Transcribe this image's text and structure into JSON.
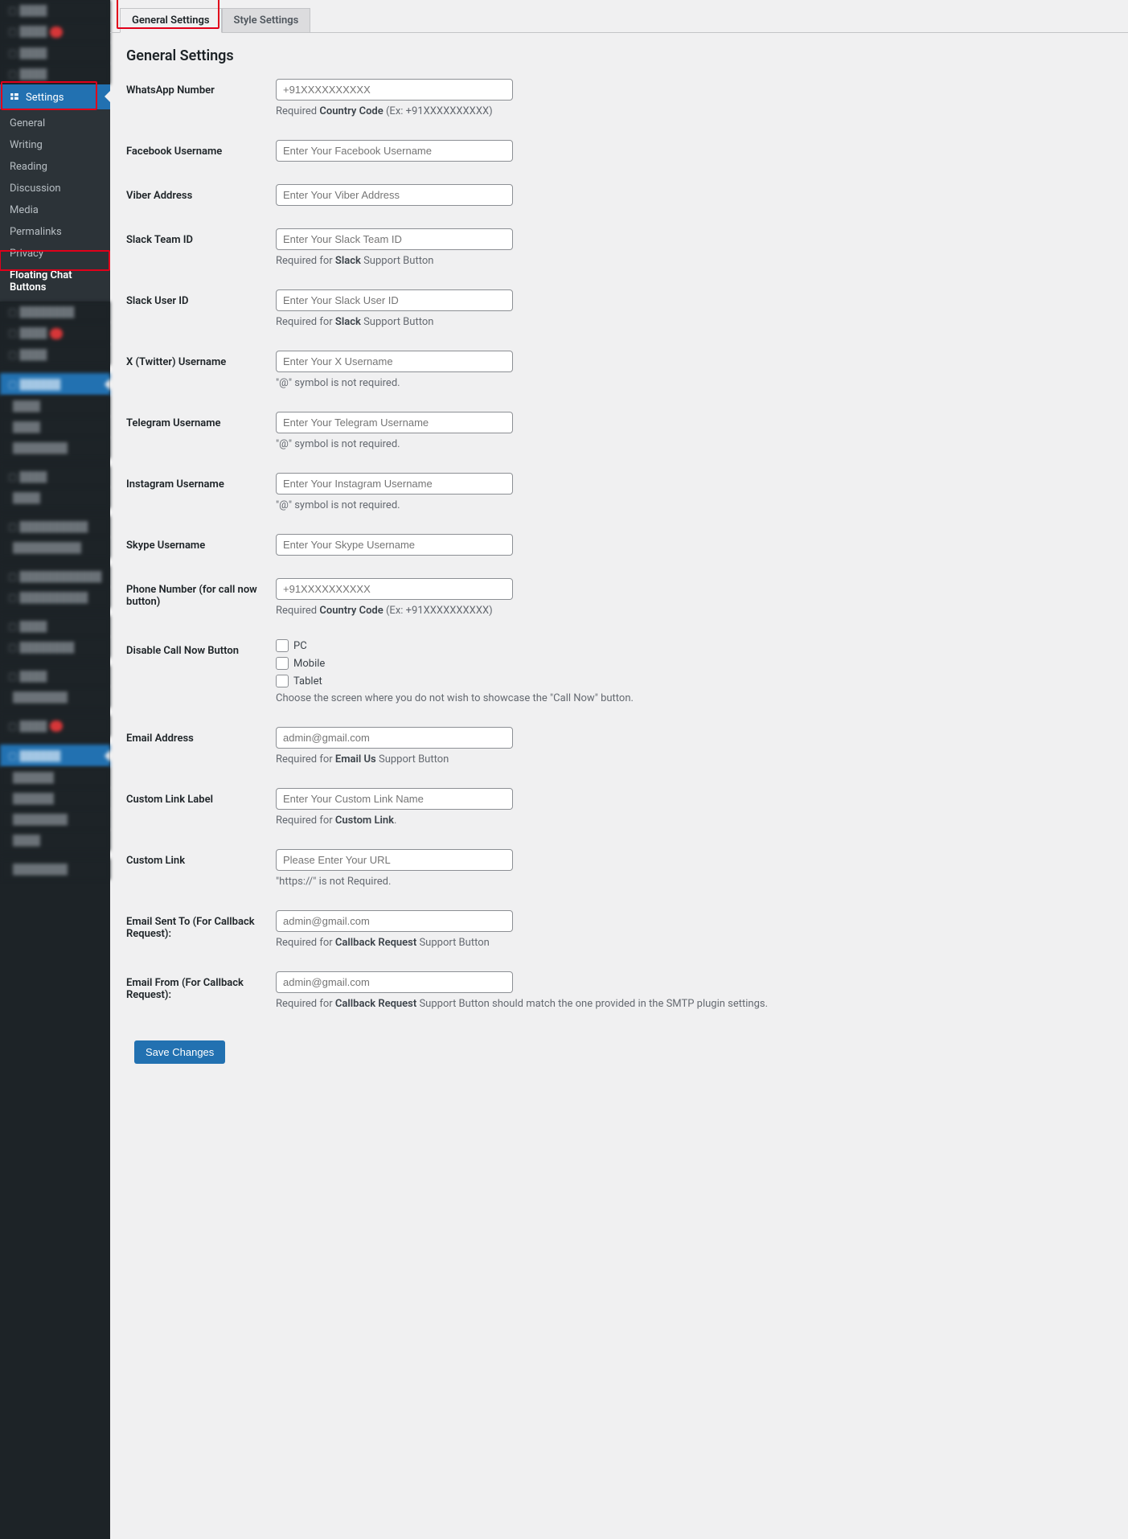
{
  "sidebar": {
    "settings_label": "Settings",
    "sub_items": [
      "General",
      "Writing",
      "Reading",
      "Discussion",
      "Media",
      "Permalinks",
      "Privacy",
      "Floating Chat Buttons"
    ]
  },
  "tabs": {
    "general": "General Settings",
    "style": "Style Settings"
  },
  "page_title": "General Settings",
  "fields": {
    "whatsapp": {
      "label": "WhatsApp Number",
      "placeholder": "+91XXXXXXXXXX",
      "desc_prefix": "Required ",
      "desc_bold": "Country Code",
      "desc_suffix": " (Ex: +91XXXXXXXXXX)"
    },
    "facebook": {
      "label": "Facebook Username",
      "placeholder": "Enter Your Facebook Username"
    },
    "viber": {
      "label": "Viber Address",
      "placeholder": "Enter Your Viber Address"
    },
    "slack_team": {
      "label": "Slack Team ID",
      "placeholder": "Enter Your Slack Team ID",
      "desc_prefix": "Required for ",
      "desc_bold": "Slack",
      "desc_suffix": " Support Button"
    },
    "slack_user": {
      "label": "Slack User ID",
      "placeholder": "Enter Your Slack User ID",
      "desc_prefix": "Required for ",
      "desc_bold": "Slack",
      "desc_suffix": " Support Button"
    },
    "twitter": {
      "label": "X (Twitter) Username",
      "placeholder": "Enter Your X Username",
      "desc_plain": "\"@\" symbol is not required."
    },
    "telegram": {
      "label": "Telegram Username",
      "placeholder": "Enter Your Telegram Username",
      "desc_plain": "\"@\" symbol is not required."
    },
    "instagram": {
      "label": "Instagram Username",
      "placeholder": "Enter Your Instagram Username",
      "desc_plain": "\"@\" symbol is not required."
    },
    "skype": {
      "label": "Skype Username",
      "placeholder": "Enter Your Skype Username"
    },
    "phone": {
      "label": "Phone Number (for call now button)",
      "placeholder": "+91XXXXXXXXXX",
      "desc_prefix": "Required ",
      "desc_bold": "Country Code",
      "desc_suffix": " (Ex: +91XXXXXXXXXX)"
    },
    "disable_call": {
      "label": "Disable Call Now Button",
      "opt_pc": "PC",
      "opt_mobile": "Mobile",
      "opt_tablet": "Tablet",
      "desc_plain": "Choose the screen where you do not wish to showcase the \"Call Now\" button."
    },
    "email": {
      "label": "Email Address",
      "placeholder": "admin@gmail.com",
      "desc_prefix": "Required for ",
      "desc_bold": "Email Us",
      "desc_suffix": " Support Button"
    },
    "custom_label": {
      "label": "Custom Link Label",
      "placeholder": "Enter Your Custom Link Name",
      "desc_prefix": "Required for ",
      "desc_bold": "Custom Link",
      "desc_suffix": "."
    },
    "custom_link": {
      "label": "Custom Link",
      "placeholder": "Please Enter Your URL",
      "desc_plain": "\"https://\" is not Required."
    },
    "email_sent_to": {
      "label": "Email Sent To (For Callback Request):",
      "placeholder": "admin@gmail.com",
      "desc_prefix": "Required for ",
      "desc_bold": "Callback Request",
      "desc_suffix": " Support Button"
    },
    "email_from": {
      "label": "Email From (For Callback Request):",
      "placeholder": "admin@gmail.com",
      "desc_prefix": "Required for ",
      "desc_bold": "Callback Request",
      "desc_suffix": " Support Button should match the one provided in the SMTP plugin settings."
    }
  },
  "save_button": "Save Changes"
}
